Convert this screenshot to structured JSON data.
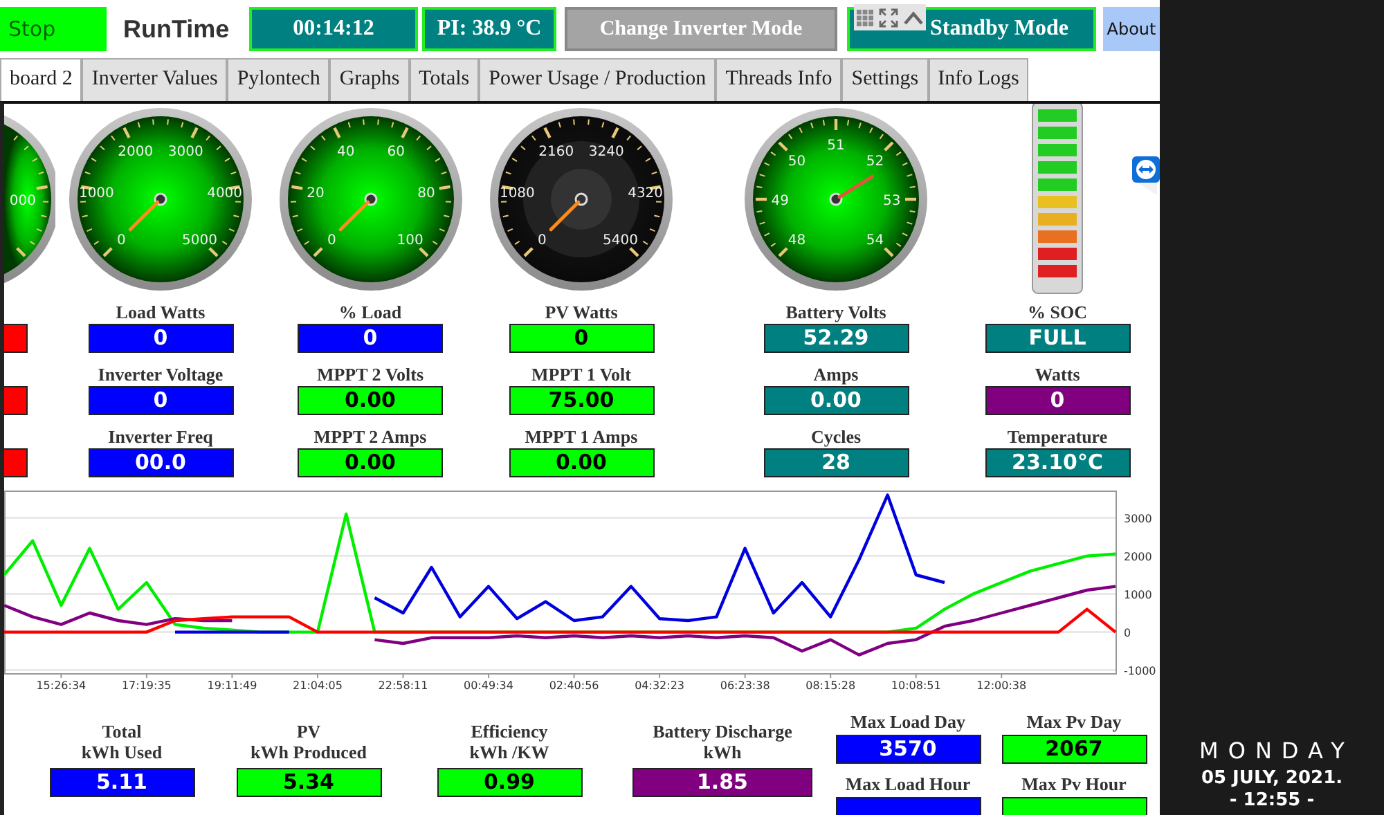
{
  "top_bar": {
    "stop_button": "Stop",
    "runtime_label": "RunTime",
    "runtime": "00:14:12",
    "pi_temperature": "PI: 38.9 °C",
    "mode_button": "Change Inverter Mode",
    "mode_status": "Standby Mode",
    "about_button": "About"
  },
  "tabs": [
    {
      "label": "board 2",
      "selected": true
    },
    {
      "label": "Inverter Values",
      "selected": false
    },
    {
      "label": "Pylontech",
      "selected": false
    },
    {
      "label": "Graphs",
      "selected": false
    },
    {
      "label": "Totals",
      "selected": false
    },
    {
      "label": "Power Usage / Production",
      "selected": false
    },
    {
      "label": "Threads Info",
      "selected": false
    },
    {
      "label": "Settings",
      "selected": false
    },
    {
      "label": "Info Logs",
      "selected": false
    }
  ],
  "gauges": [
    {
      "kind": "partial",
      "labels": [
        "000"
      ]
    },
    {
      "kind": "dial",
      "labels": [
        "0",
        "1000",
        "2000",
        "3000",
        "4000",
        "5000"
      ]
    },
    {
      "kind": "dial",
      "labels": [
        "0",
        "20",
        "40",
        "60",
        "80",
        "100"
      ]
    },
    {
      "kind": "dark-dial",
      "labels": [
        "0",
        "1080",
        "2160",
        "3240",
        "4320",
        "5400"
      ]
    },
    {
      "kind": "dial",
      "labels": [
        "48",
        "49",
        "50",
        "51",
        "52",
        "53",
        "54"
      ]
    }
  ],
  "reading_columns": [
    [
      {
        "color": "#ff0000"
      },
      {
        "color": "#ff0000"
      },
      {
        "color": "#ff0000"
      }
    ],
    [
      {
        "label": "Load Watts",
        "value": "0",
        "color": "#0000ff"
      },
      {
        "label": "Inverter Voltage",
        "value": "0",
        "color": "#0000ff"
      },
      {
        "label": "Inverter Freq",
        "value": "00.0",
        "color": "#0000ff"
      }
    ],
    [
      {
        "label": "% Load",
        "value": "0",
        "color": "#0000ff"
      },
      {
        "label": "MPPT 2 Volts",
        "value": "0.00",
        "color": "#00ff00"
      },
      {
        "label": "MPPT 2 Amps",
        "value": "0.00",
        "color": "#00ff00"
      }
    ],
    [
      {
        "label": "PV Watts",
        "value": "0",
        "color": "#00ff00"
      },
      {
        "label": "MPPT 1 Volt",
        "value": "75.00",
        "color": "#00ff00"
      },
      {
        "label": "MPPT 1 Amps",
        "value": "0.00",
        "color": "#00ff00"
      }
    ],
    [
      {
        "label": "Battery Volts",
        "value": "52.29",
        "color": "#008080"
      },
      {
        "label": "Amps",
        "value": "0.00",
        "color": "#008080"
      },
      {
        "label": "Cycles",
        "value": "28",
        "color": "#008080"
      }
    ],
    [
      {
        "label": "% SOC",
        "value": "FULL",
        "color": "#008080"
      },
      {
        "label": "Watts",
        "value": "0",
        "color": "#800080"
      },
      {
        "label": "Temperature",
        "value": "23.10°C",
        "color": "#008080"
      }
    ]
  ],
  "chart": {
    "chart_data": {
      "type": "line",
      "categories": [
        null,
        null,
        "15:26:34",
        null,
        null,
        "17:19:35",
        null,
        null,
        "19:11:49",
        null,
        null,
        "21:04:05",
        null,
        null,
        "22:58:11",
        null,
        null,
        "00:49:34",
        null,
        null,
        "02:40:56",
        null,
        null,
        "04:32:23",
        null,
        null,
        "06:23:38",
        null,
        null,
        "08:15:28",
        null,
        null,
        "10:08:51",
        null,
        null,
        "12:00:38",
        null,
        null,
        null,
        null
      ],
      "ylim": [
        -1100,
        3700
      ],
      "grid": true,
      "yticks": [
        -1000,
        0,
        1000,
        2000,
        3000
      ],
      "series": [
        {
          "color": "#00ee00",
          "values": [
            1500,
            2400,
            700,
            2200,
            600,
            1300,
            200,
            100,
            50,
            0,
            0,
            0,
            3100,
            0,
            0,
            0,
            0,
            0,
            0,
            0,
            0,
            0,
            0,
            0,
            0,
            0,
            0,
            0,
            0,
            0,
            0,
            0,
            100,
            600,
            1000,
            1300,
            1600,
            1800,
            2000,
            2050
          ]
        },
        {
          "color": "#800080",
          "values": [
            700,
            400,
            200,
            500,
            300,
            200,
            350,
            300,
            300,
            null,
            null,
            null,
            null,
            -200,
            -300,
            -150,
            -150,
            -150,
            -100,
            -150,
            -100,
            -150,
            -100,
            -150,
            -100,
            -150,
            -100,
            -150,
            -500,
            -200,
            -600,
            -300,
            -200,
            150,
            300,
            500,
            700,
            900,
            1100,
            1200
          ]
        },
        {
          "color": "#0000dd",
          "values": [
            null,
            null,
            null,
            null,
            null,
            null,
            0,
            0,
            0,
            0,
            0,
            null,
            null,
            900,
            500,
            1700,
            400,
            1200,
            350,
            800,
            300,
            400,
            1200,
            350,
            300,
            400,
            2200,
            500,
            1300,
            400,
            1900,
            3600,
            1500,
            1300,
            null,
            null,
            null,
            null,
            null,
            null
          ]
        },
        {
          "color": "#ff0000",
          "values": [
            0,
            0,
            0,
            0,
            0,
            0,
            300,
            350,
            400,
            400,
            400,
            0,
            0,
            0,
            0,
            0,
            0,
            0,
            0,
            0,
            0,
            0,
            0,
            0,
            0,
            0,
            0,
            0,
            0,
            0,
            0,
            0,
            0,
            0,
            0,
            0,
            0,
            0,
            600,
            0
          ]
        }
      ]
    }
  },
  "totals": [
    {
      "label": "Total\nkWh Used",
      "value": "5.11",
      "color": "#0000ff"
    },
    {
      "label": "PV\nkWh Produced",
      "value": "5.34",
      "color": "#00ff00"
    },
    {
      "label": "Efficiency\nkWh /KW",
      "value": "0.99",
      "color": "#00ff00"
    },
    {
      "label": "Battery Discharge kWh",
      "value": "1.85",
      "color": "#800080"
    }
  ],
  "max_stats": [
    {
      "label": "Max Load Day",
      "value": "3570",
      "color": "#0000ff"
    },
    {
      "label": "Max Pv Day",
      "value": "2067",
      "color": "#00ff00"
    },
    {
      "label": "Max Load Hour",
      "color": "#0000ff"
    },
    {
      "label": "Max Pv Hour",
      "color": "#00ff00"
    }
  ],
  "clock": {
    "day": "MONDAY",
    "date": "05 JULY, 2021.",
    "time": "- 12:55 -"
  }
}
